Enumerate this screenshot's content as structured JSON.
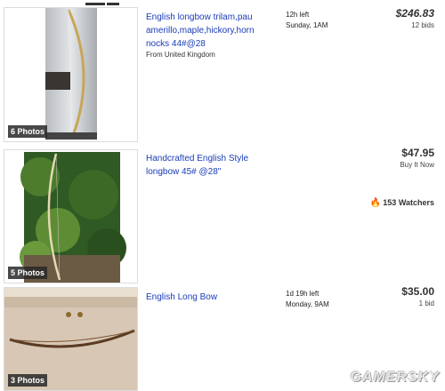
{
  "listings": [
    {
      "title": "English longbow trilam,pau amerillo,maple,hickory,horn nocks 44#@28",
      "origin": "From United Kingdom",
      "time_left": "12h left",
      "end_time": "Sunday, 1AM",
      "price": "$246.83",
      "sub": "12 bids",
      "photos": "6 Photos"
    },
    {
      "title": "Handcrafted English Style longbow 45# @28\"",
      "price": "$47.95",
      "sub": "Buy It Now",
      "watchers": "153 Watchers",
      "photos": "5 Photos"
    },
    {
      "title": "English Long Bow",
      "time_left": "1d 19h left",
      "end_time": "Monday, 9AM",
      "price": "$35.00",
      "sub": "1 bid",
      "photos": "3 Photos"
    }
  ],
  "watermark": "GAMERSKY",
  "icons": {
    "watchers": "flame-icon"
  }
}
